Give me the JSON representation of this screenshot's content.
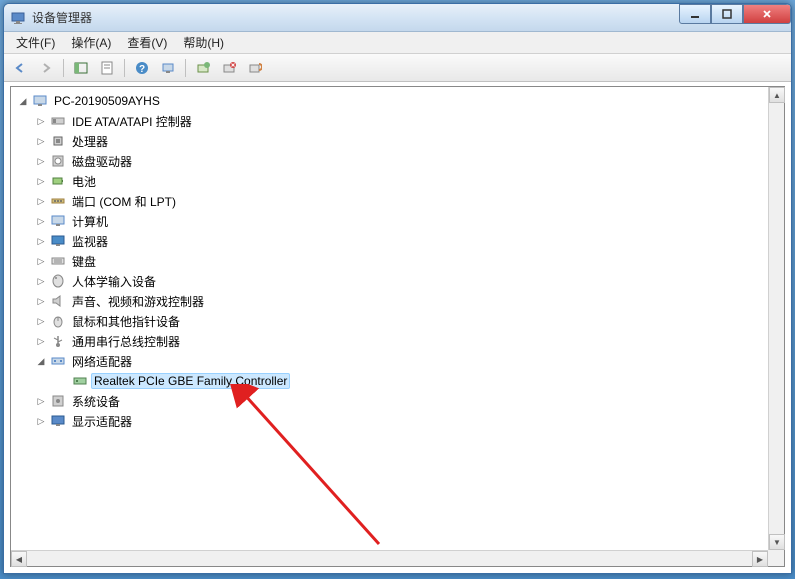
{
  "window": {
    "title": "设备管理器"
  },
  "menu": {
    "items": [
      "文件(F)",
      "操作(A)",
      "查看(V)",
      "帮助(H)"
    ]
  },
  "tree": {
    "root": "PC-20190509AYHS",
    "categories": [
      {
        "label": "IDE ATA/ATAPI 控制器",
        "icon": "ide"
      },
      {
        "label": "处理器",
        "icon": "cpu"
      },
      {
        "label": "磁盘驱动器",
        "icon": "disk"
      },
      {
        "label": "电池",
        "icon": "battery"
      },
      {
        "label": "端口 (COM 和 LPT)",
        "icon": "port"
      },
      {
        "label": "计算机",
        "icon": "computer"
      },
      {
        "label": "监视器",
        "icon": "monitor"
      },
      {
        "label": "键盘",
        "icon": "keyboard"
      },
      {
        "label": "人体学输入设备",
        "icon": "hid"
      },
      {
        "label": "声音、视频和游戏控制器",
        "icon": "sound"
      },
      {
        "label": "鼠标和其他指针设备",
        "icon": "mouse"
      },
      {
        "label": "通用串行总线控制器",
        "icon": "usb"
      },
      {
        "label": "网络适配器",
        "icon": "network",
        "expanded": true,
        "children": [
          {
            "label": "Realtek PCIe GBE Family Controller",
            "icon": "nic",
            "selected": true
          }
        ]
      },
      {
        "label": "系统设备",
        "icon": "system"
      },
      {
        "label": "显示适配器",
        "icon": "display"
      }
    ]
  }
}
